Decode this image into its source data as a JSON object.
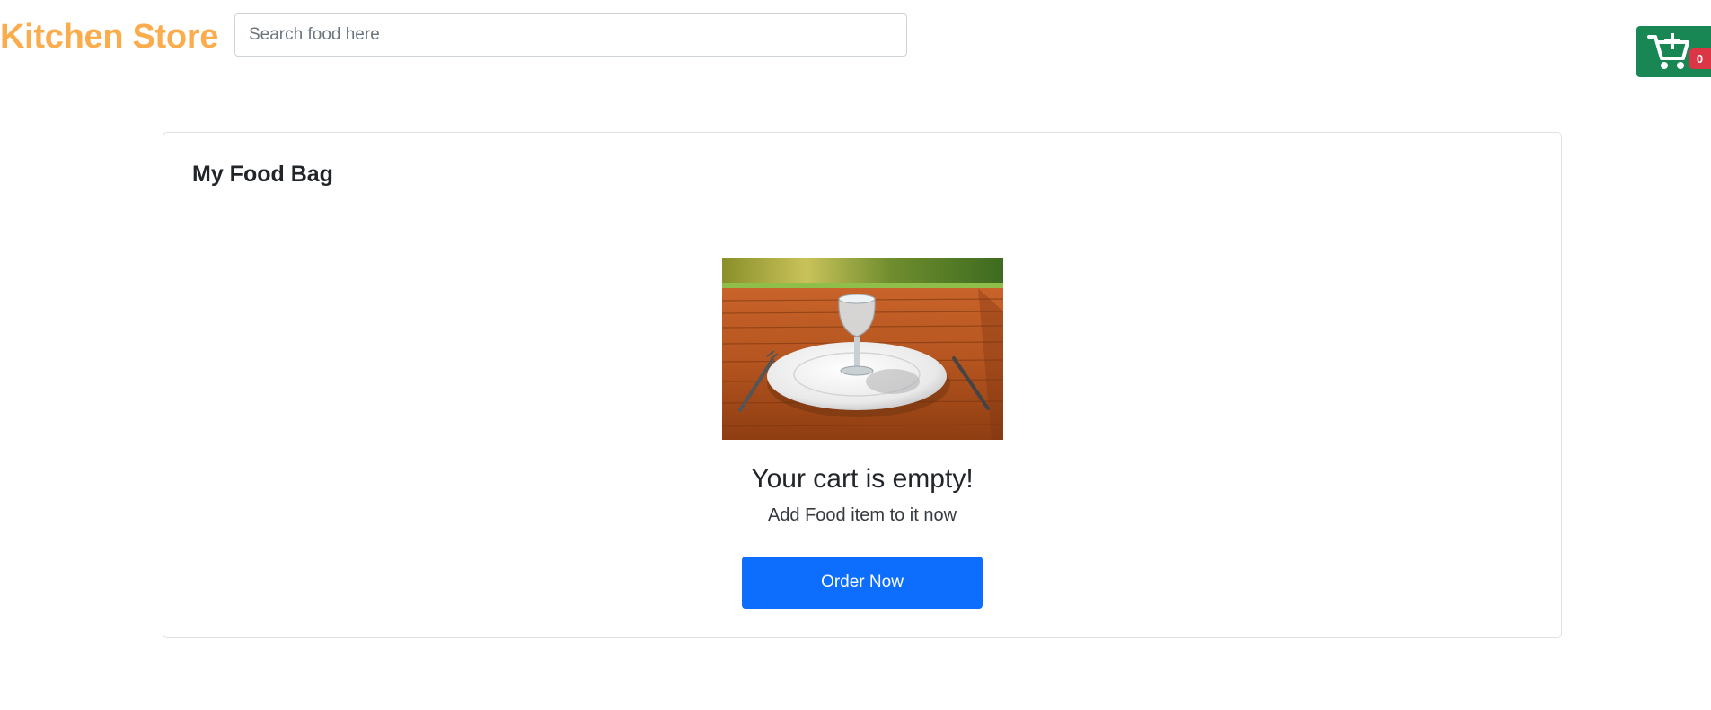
{
  "header": {
    "brand": "Kitchen Store",
    "search_placeholder": "Search food here",
    "search_value": "",
    "cart_count": "0"
  },
  "card": {
    "title": "My Food Bag",
    "empty_title": "Your cart is empty!",
    "empty_subtitle": "Add Food item to it now",
    "order_button": "Order Now"
  },
  "colors": {
    "brand": "#fbac4c",
    "cart_button": "#198754",
    "badge": "#dc3545",
    "primary_button": "#0d6efd"
  },
  "icons": {
    "cart": "cart-plus-icon",
    "illustration": "empty-plate-illustration"
  }
}
